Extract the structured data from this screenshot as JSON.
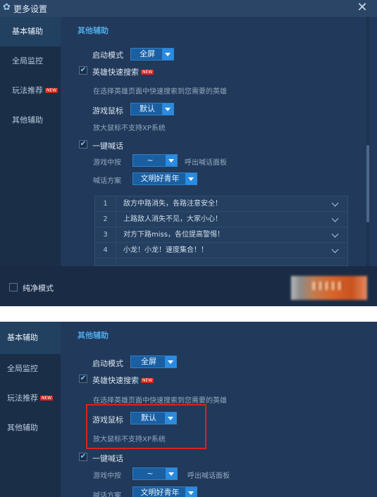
{
  "window": {
    "title": "更多设置",
    "close_glyph": "✕"
  },
  "sidebar": {
    "items": [
      {
        "label": "基本辅助",
        "active": true
      },
      {
        "label": "全局监控",
        "active": false
      },
      {
        "label": "玩法推荐",
        "active": false,
        "badge": "NEW"
      },
      {
        "label": "其他辅助",
        "active": false
      }
    ]
  },
  "section": {
    "title": "其他辅助"
  },
  "settings": {
    "start_mode": {
      "label": "启动模式",
      "value": "全屏"
    },
    "hero_search": {
      "label": "英雄快速搜索",
      "badge": "NEW",
      "checked": true,
      "desc": "在选择英雄页面中快速搜索到您需要的英雄"
    },
    "game_mouse": {
      "label": "游戏鼠标",
      "value": "默认",
      "desc": "放大鼠标不支持XP系统"
    },
    "one_click_chat": {
      "label": "一键喊话",
      "checked": true
    },
    "in_game_press": {
      "label": "游戏中按",
      "value": "~",
      "suffix": "呼出喊话面板"
    },
    "chat_scheme": {
      "label": "喊话方案",
      "value": "文明好青年"
    }
  },
  "chat_lines": [
    {
      "num": "1",
      "text": "敌方中路消失，各路注意安全！"
    },
    {
      "num": "2",
      "text": "上路敌人消失不见，大家小心！"
    },
    {
      "num": "3",
      "text": "对方下路miss，各位提高警惕！"
    },
    {
      "num": "4",
      "text": "小龙！小龙！速度集合！！"
    }
  ],
  "footer": {
    "pure_mode_label": "纯净模式",
    "pure_mode_checked": false
  },
  "colors": {
    "accent": "#4fa9e8",
    "background": "#1d3350",
    "highlight_box": "#e0201c",
    "new_badge": "#d8261f"
  },
  "icons": {
    "title": "gear-icon",
    "close": "close-icon",
    "check": "checkmark-icon",
    "dropdown": "caret-down-icon",
    "row_expand": "chevron-down-icon"
  }
}
